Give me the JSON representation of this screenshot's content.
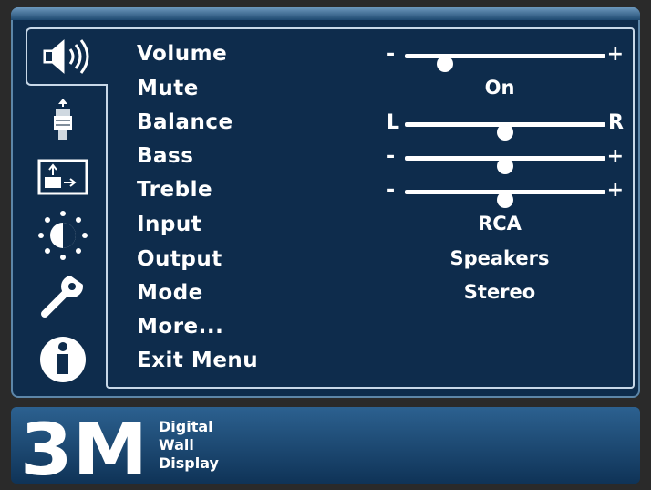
{
  "menu": {
    "items": [
      {
        "label": "Volume",
        "type": "slider",
        "left": "-",
        "right": "+",
        "level": 0.2
      },
      {
        "label": "Mute",
        "type": "value",
        "value": "On"
      },
      {
        "label": "Balance",
        "type": "slider",
        "left": "L",
        "right": "R",
        "level": 0.5
      },
      {
        "label": "Bass",
        "type": "slider",
        "left": "-",
        "right": "+",
        "level": 0.5
      },
      {
        "label": "Treble",
        "type": "slider",
        "left": "-",
        "right": "+",
        "level": 0.5
      },
      {
        "label": "Input",
        "type": "value",
        "value": "RCA"
      },
      {
        "label": "Output",
        "type": "value",
        "value": "Speakers"
      },
      {
        "label": "Mode",
        "type": "value",
        "value": "Stereo"
      },
      {
        "label": "More...",
        "type": "none"
      },
      {
        "label": "Exit Menu",
        "type": "none"
      }
    ]
  },
  "sidebar": {
    "icons": [
      "speaker-icon",
      "av-connector-icon",
      "picture-position-icon",
      "brightness-icon",
      "wrench-icon",
      "info-icon"
    ]
  },
  "brand": {
    "logo": "3M",
    "line1": "Digital",
    "line2": "Wall",
    "line3": "Display"
  },
  "colors": {
    "panel": "#0e2c4c",
    "frame": "#c8d8e8",
    "text": "#ffffff"
  }
}
